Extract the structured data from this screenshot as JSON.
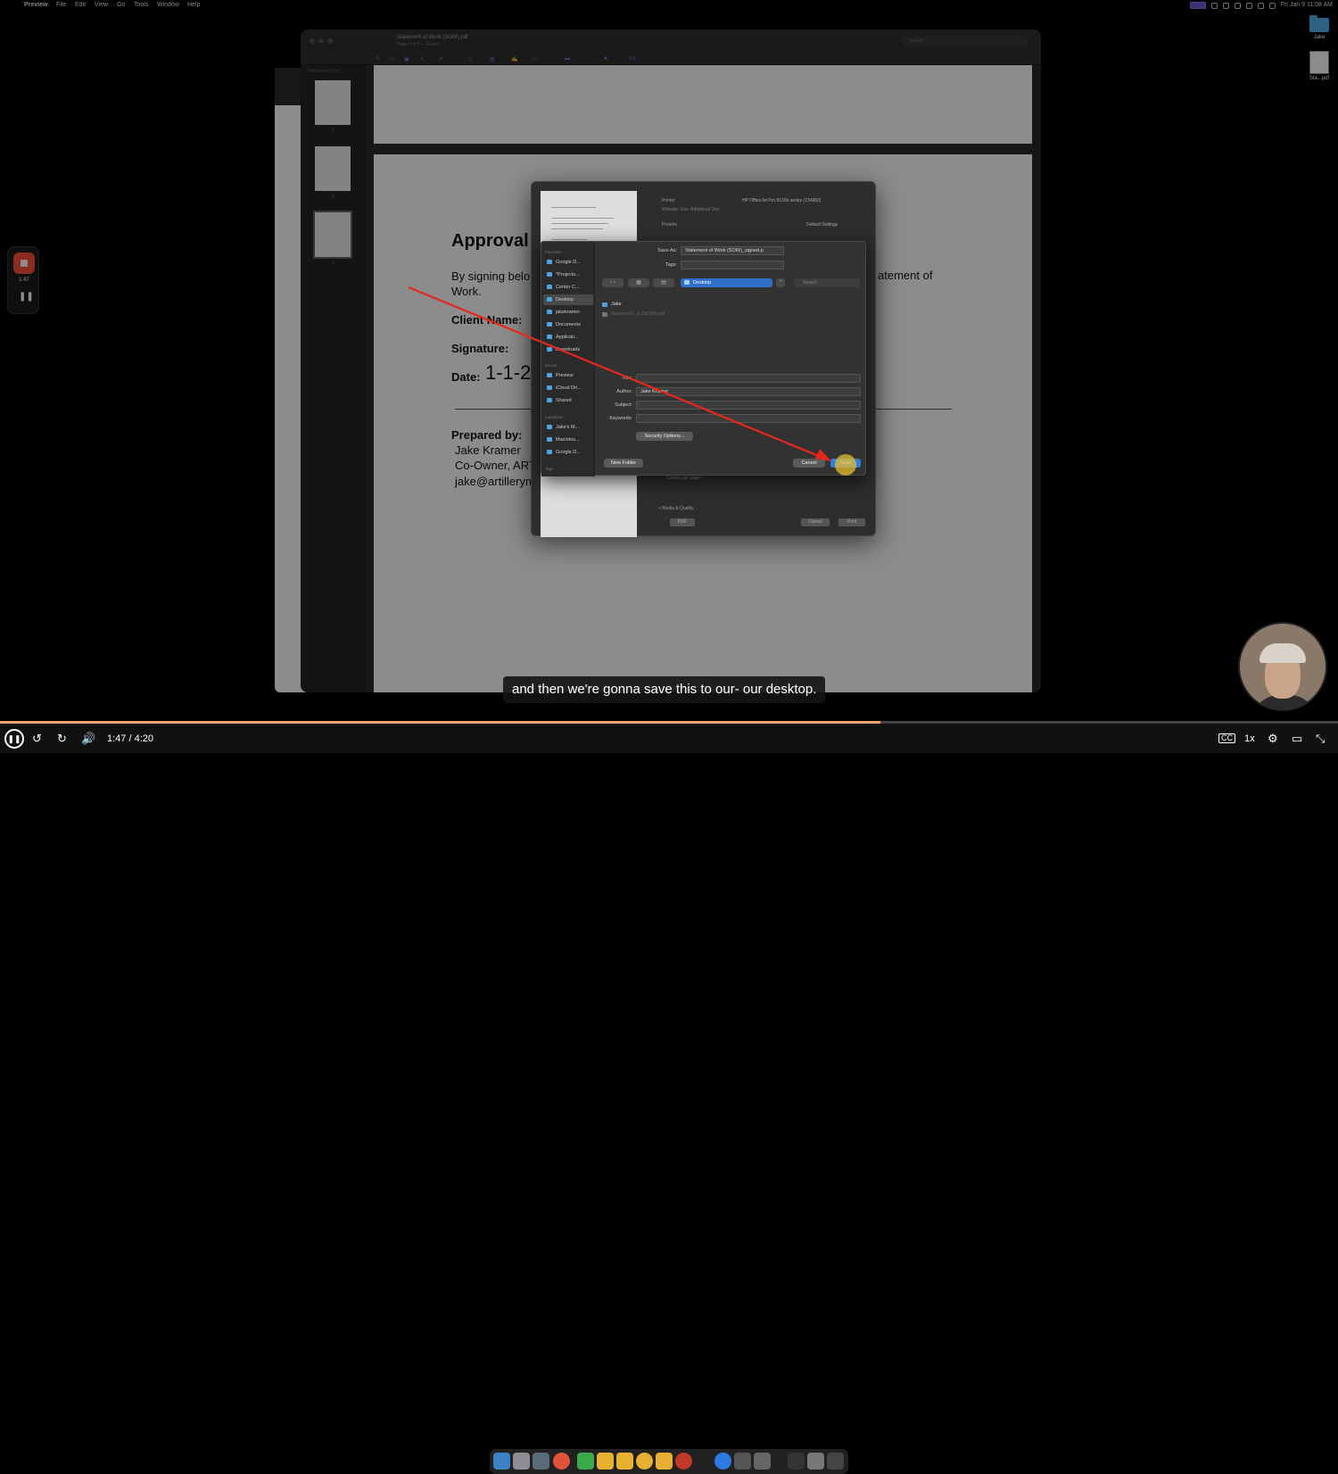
{
  "menubar": {
    "app_name": "Preview",
    "menus": [
      "File",
      "Edit",
      "View",
      "Go",
      "Tools",
      "Window",
      "Help"
    ],
    "clock": "Fri Jan 9  11:08 AM"
  },
  "desktop": {
    "folder_label": "Jake",
    "file_label": "Sta...pdf"
  },
  "recorder": {
    "time": "1:47"
  },
  "preview": {
    "title": "Statement of Work (SOW).pdf",
    "subtitle": "Page 3 of 3 — Edited",
    "search_placeholder": "Search",
    "sidebar_label": "Statement of W...",
    "thumb_numbers": [
      "1",
      "2",
      "3"
    ]
  },
  "document": {
    "heading": "Approval",
    "para_start": "By signing belo",
    "para_line2": "Work.",
    "para_end": "atement of",
    "client_label": "Client Name:",
    "signature_label": "Signature:",
    "date_label": "Date:",
    "date_value": "1-1-2",
    "prepared_label": "Prepared by:",
    "prepared_name": "Jake Kramer",
    "prepared_role": "Co-Owner, ART",
    "prepared_email": "jake@artillerym"
  },
  "print_dialog": {
    "printer_label": "Printer",
    "printer_value": "HP OfficeJet Pro 8130e series (734982)",
    "printer_sub": "Website: Use, Additional Use",
    "presets_label": "Presets",
    "presets_value": "Default Settings",
    "copies_label": "Copies per page:",
    "media_label": "> Media & Quality",
    "pdf_button": "PDF",
    "cancel_button": "Cancel",
    "print_button": "Print"
  },
  "save_dialog": {
    "save_as_label": "Save As:",
    "save_as_value": "Statement of Work (SOW)_signed.p",
    "tags_label": "Tags:",
    "location": "Desktop",
    "search_placeholder": "Search",
    "sidebar": {
      "favorites_label": "Favorites",
      "favorites": [
        "Google D...",
        "*Projects...",
        "Center C...",
        "Desktop",
        "jakekramer",
        "Documents",
        "Applicati...",
        "Downloads"
      ],
      "selected": "Desktop",
      "icloud_label": "iCloud",
      "icloud": [
        "Preview",
        "iCloud Dri...",
        "Shared"
      ],
      "locations_label": "Locations",
      "locations": [
        "Jake's M...",
        "Macintos...",
        "Google D..."
      ],
      "tags_label": "Tags"
    },
    "files": [
      {
        "name": "Jake",
        "kind": "folder"
      },
      {
        "name": "Statement...k (SOW).pdf",
        "kind": "file"
      }
    ],
    "title_label": "Title:",
    "author_label": "Author:",
    "author_value": "Jake Kramer",
    "subject_label": "Subject:",
    "keywords_label": "Keywords:",
    "security_button": "Security Options...",
    "new_folder_button": "New Folder",
    "cancel_button": "Cancel",
    "save_button": "Save"
  },
  "caption": "and then we're gonna save this to our- our desktop.",
  "player": {
    "time": "1:47 / 4:20",
    "progress": 0.658,
    "speed": "1x",
    "cc_label": "CC"
  },
  "colors": {
    "accent": "#2f7de1",
    "record": "#ff4f3a",
    "annotation_arrow": "#e8261c",
    "progress": "#f0a070"
  }
}
